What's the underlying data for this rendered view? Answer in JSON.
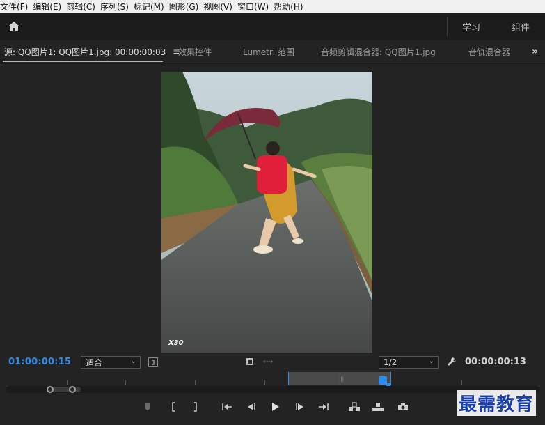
{
  "menu": [
    "文件(F)",
    "编辑(E)",
    "剪辑(C)",
    "序列(S)",
    "标记(M)",
    "图形(G)",
    "视图(V)",
    "窗口(W)",
    "帮助(H)"
  ],
  "header": {
    "workspaces": [
      "学习",
      "组件"
    ]
  },
  "tabs": {
    "source": "源: QQ图片1: QQ图片1.jpg: 00:00:00:03",
    "effect_controls": "效果控件",
    "lumetri": "Lumetri 范围",
    "audio_clip_mixer": "音频剪辑混合器: QQ图片1.jpg",
    "audio_track_mixer": "音轨混合器",
    "overflow": "»",
    "menu_glyph": "≡"
  },
  "frame": {
    "overlay": "X30"
  },
  "controls": {
    "timecode_current": "01:00:00:15",
    "zoom_select": "适合",
    "resolution_select": "1/2",
    "timecode_duration": "00:00:00:13"
  },
  "colors": {
    "accent_blue": "#2d8ceb",
    "panel_bg": "#232323",
    "header_bg": "#1b1b1b"
  },
  "icons": {
    "home": "home-icon",
    "settings": "wrench-icon",
    "export_frame": "camera-icon"
  },
  "watermark": "最需教育"
}
